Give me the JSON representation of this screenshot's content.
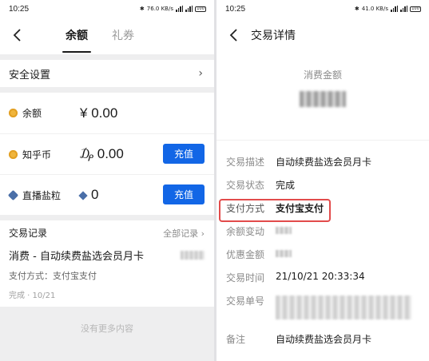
{
  "left": {
    "status": {
      "time": "10:25",
      "net": "76.0 KB/s",
      "battery": "100"
    },
    "tabs": [
      "余额",
      "礼券"
    ],
    "security": {
      "label": "安全设置"
    },
    "assets": [
      {
        "label": "余额",
        "symbol": "¥",
        "value": "0.00",
        "icon": "coin-icon"
      },
      {
        "label": "知乎币",
        "symbol": "₯",
        "value": "0.00",
        "icon": "coin-icon",
        "button": "充值"
      },
      {
        "label": "直播盐粒",
        "symbol": "",
        "value": "0",
        "icon": "gem-icon",
        "button": "充值"
      }
    ],
    "records": {
      "title": "交易记录",
      "all": "全部记录",
      "item": {
        "name": "消费 - 自动续费盐选会员月卡",
        "pay": "支付方式：支付宝支付",
        "status": "完成 · 10/21"
      }
    },
    "no_more": "没有更多内容"
  },
  "right": {
    "status": {
      "time": "10:25",
      "net": "41.0 KB/s",
      "battery": "100"
    },
    "title": "交易详情",
    "amount_label": "消费金额",
    "details": [
      {
        "key": "交易描述",
        "value": "自动续费盐选会员月卡"
      },
      {
        "key": "交易状态",
        "value": "完成"
      },
      {
        "key": "支付方式",
        "value": "支付宝支付"
      },
      {
        "key": "余额变动",
        "value": ""
      },
      {
        "key": "优惠金额",
        "value": ""
      },
      {
        "key": "交易时间",
        "value": "21/10/21 20:33:34"
      },
      {
        "key": "交易单号",
        "value": ""
      },
      {
        "key": "备注",
        "value": "自动续费盐选会员月卡"
      }
    ],
    "highlight_color": "#e24b4b"
  },
  "colors": {
    "accent": "#1266e6"
  }
}
